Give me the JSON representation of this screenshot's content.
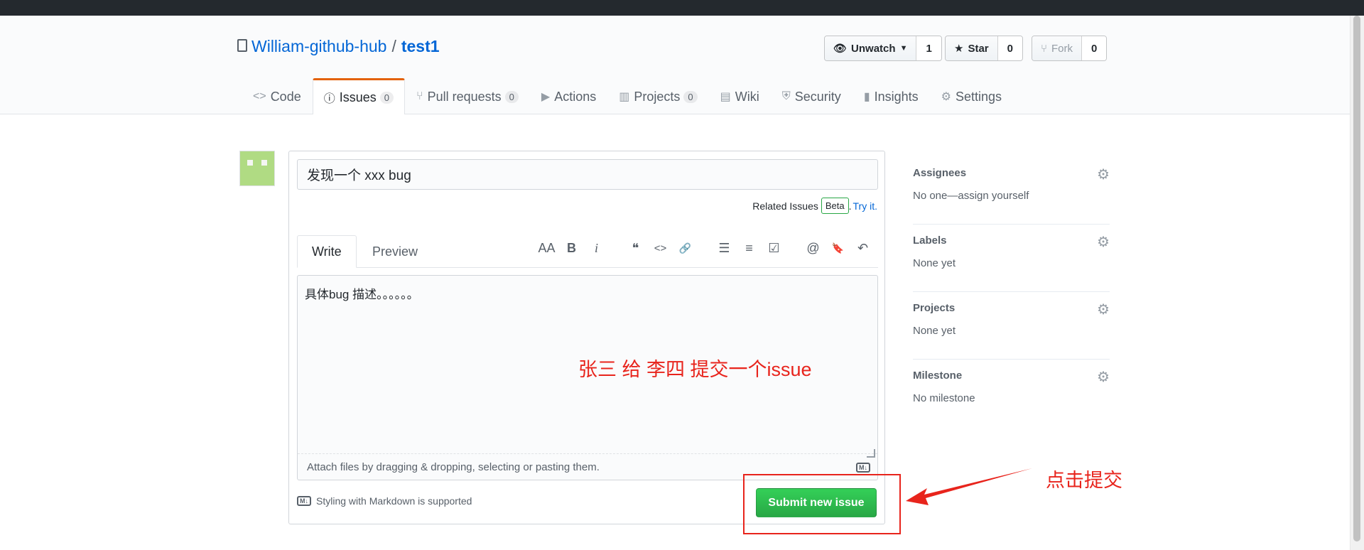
{
  "repo": {
    "owner": "William-github-hub",
    "separator": "/",
    "name": "test1"
  },
  "actions": [
    {
      "label": "Unwatch",
      "count": "1",
      "icon": "eye-icon"
    },
    {
      "label": "Star",
      "count": "0",
      "icon": "star-icon"
    },
    {
      "label": "Fork",
      "count": "0",
      "icon": "fork-icon"
    }
  ],
  "nav": [
    {
      "label": "Code",
      "icon": "code-icon"
    },
    {
      "label": "Issues",
      "count": "0",
      "icon": "issue-icon"
    },
    {
      "label": "Pull requests",
      "count": "0",
      "icon": "pull-request-icon"
    },
    {
      "label": "Actions",
      "icon": "play-icon"
    },
    {
      "label": "Projects",
      "count": "0",
      "icon": "project-icon"
    },
    {
      "label": "Wiki",
      "icon": "book-icon"
    },
    {
      "label": "Security",
      "icon": "shield-icon"
    },
    {
      "label": "Insights",
      "icon": "graph-icon"
    },
    {
      "label": "Settings",
      "icon": "gear-icon"
    }
  ],
  "issue": {
    "title": "发现一个 xxx bug",
    "body": "具体bug 描述。。。。。。",
    "related_label": "Related Issues",
    "beta": "Beta",
    "dot": ".",
    "try_it": "Try it.",
    "tab_write": "Write",
    "tab_preview": "Preview",
    "attach_hint": "Attach files by dragging & dropping, selecting or pasting them.",
    "markdown_hint": "Styling with Markdown is supported",
    "md_badge": "M↓",
    "submit_label": "Submit new issue"
  },
  "toolbar": {
    "heading": "AA",
    "bold": "B",
    "italic": "i",
    "quote": "❝",
    "code": "<>",
    "link": "🔗",
    "ul": "☰",
    "ol": "≡",
    "task": "☑",
    "mention": "@",
    "ref": "🔖",
    "reply": "↶"
  },
  "sidebar": [
    {
      "heading": "Assignees",
      "value": "No one—assign yourself"
    },
    {
      "heading": "Labels",
      "value": "None yet"
    },
    {
      "heading": "Projects",
      "value": "None yet"
    },
    {
      "heading": "Milestone",
      "value": "No milestone"
    }
  ],
  "annotations": {
    "body_note": "张三 给 李四 提交一个issue",
    "click_note": "点击提交"
  },
  "colors": {
    "accent": "#0366d6",
    "submit": "#28a745",
    "annotation": "#e8241c",
    "tab_active": "#e36209"
  }
}
